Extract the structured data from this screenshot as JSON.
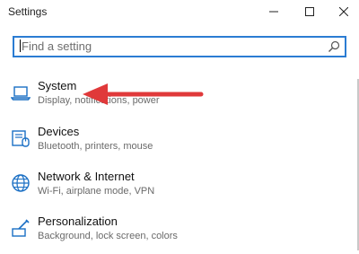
{
  "window": {
    "title": "Settings",
    "controls": {
      "minimize": "minimize",
      "maximize": "maximize",
      "close": "close"
    }
  },
  "search": {
    "placeholder": "Find a setting",
    "icon": "search-icon"
  },
  "categories": [
    {
      "label": "System",
      "description": "Display, notifications, power",
      "icon": "laptop-icon"
    },
    {
      "label": "Devices",
      "description": "Bluetooth, printers, mouse",
      "icon": "devices-icon"
    },
    {
      "label": "Network & Internet",
      "description": "Wi-Fi, airplane mode, VPN",
      "icon": "globe-icon"
    },
    {
      "label": "Personalization",
      "description": "Background, lock screen, colors",
      "icon": "personalization-icon"
    }
  ],
  "annotation": {
    "color": "#e0393a"
  },
  "colors": {
    "accent": "#2b7cd3",
    "icon": "#1a6fc4"
  }
}
